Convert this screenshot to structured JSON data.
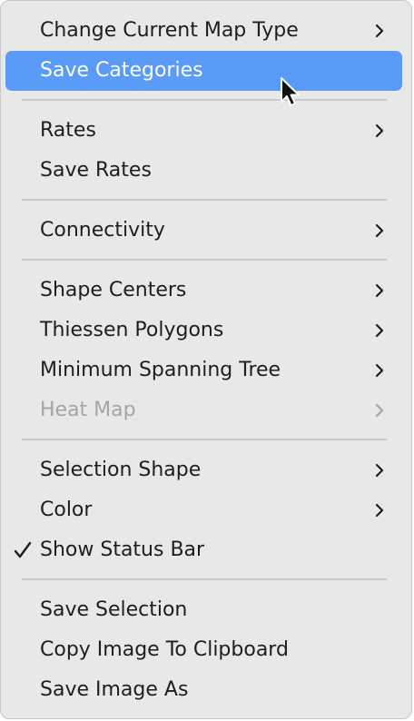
{
  "menu": {
    "items": [
      {
        "label": "Change Current Map Type",
        "submenu": true,
        "checked": false,
        "disabled": false,
        "highlighted": false
      },
      {
        "label": "Save Categories",
        "submenu": false,
        "checked": false,
        "disabled": false,
        "highlighted": true
      },
      {
        "label": "Rates",
        "submenu": true,
        "checked": false,
        "disabled": false,
        "highlighted": false
      },
      {
        "label": "Save Rates",
        "submenu": false,
        "checked": false,
        "disabled": false,
        "highlighted": false
      },
      {
        "label": "Connectivity",
        "submenu": true,
        "checked": false,
        "disabled": false,
        "highlighted": false
      },
      {
        "label": "Shape Centers",
        "submenu": true,
        "checked": false,
        "disabled": false,
        "highlighted": false
      },
      {
        "label": "Thiessen Polygons",
        "submenu": true,
        "checked": false,
        "disabled": false,
        "highlighted": false
      },
      {
        "label": "Minimum Spanning Tree",
        "submenu": true,
        "checked": false,
        "disabled": false,
        "highlighted": false
      },
      {
        "label": "Heat Map",
        "submenu": true,
        "checked": false,
        "disabled": true,
        "highlighted": false
      },
      {
        "label": "Selection Shape",
        "submenu": true,
        "checked": false,
        "disabled": false,
        "highlighted": false
      },
      {
        "label": "Color",
        "submenu": true,
        "checked": false,
        "disabled": false,
        "highlighted": false
      },
      {
        "label": "Show Status Bar",
        "submenu": false,
        "checked": true,
        "disabled": false,
        "highlighted": false
      },
      {
        "label": "Save Selection",
        "submenu": false,
        "checked": false,
        "disabled": false,
        "highlighted": false
      },
      {
        "label": "Copy Image To Clipboard",
        "submenu": false,
        "checked": false,
        "disabled": false,
        "highlighted": false
      },
      {
        "label": "Save Image As",
        "submenu": false,
        "checked": false,
        "disabled": false,
        "highlighted": false
      }
    ]
  },
  "icons": {
    "submenu": "chevron-right-icon",
    "check": "checkmark-icon",
    "cursor": "mouse-pointer-icon"
  },
  "colors": {
    "menu_background": "#e7e8e7",
    "highlight": "#5a9bf7",
    "text": "#1e1e1e",
    "disabled_text": "#a4a6a4",
    "separator": "#c9cac9"
  }
}
